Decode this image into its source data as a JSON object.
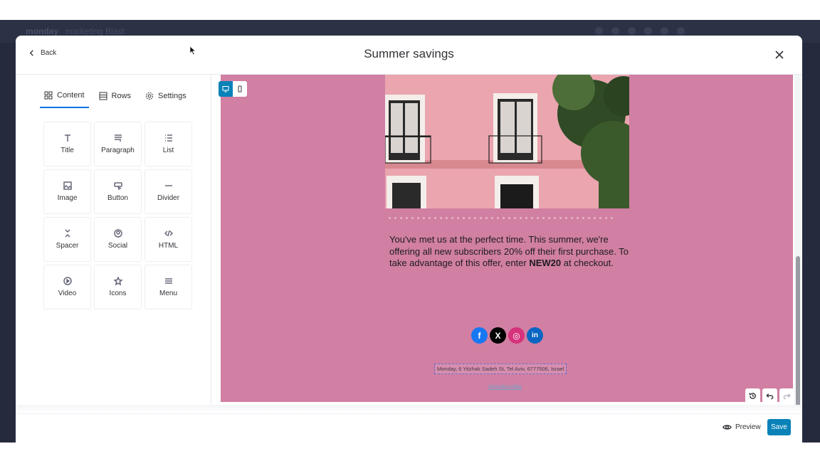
{
  "backdrop": {
    "logo": "monday",
    "crumb": "marketing   Blast"
  },
  "modal": {
    "title": "Summer savings",
    "back_label": "Back"
  },
  "panel": {
    "tabs": [
      {
        "label": "Content",
        "icon": "grid-icon"
      },
      {
        "label": "Rows",
        "icon": "rows-icon"
      },
      {
        "label": "Settings",
        "icon": "gear-icon"
      }
    ],
    "blocks": [
      {
        "label": "Title",
        "icon": "text-t-icon"
      },
      {
        "label": "Paragraph",
        "icon": "paragraph-icon"
      },
      {
        "label": "List",
        "icon": "list-icon"
      },
      {
        "label": "Image",
        "icon": "image-icon"
      },
      {
        "label": "Button",
        "icon": "button-icon"
      },
      {
        "label": "Divider",
        "icon": "divider-icon"
      },
      {
        "label": "Spacer",
        "icon": "spacer-icon"
      },
      {
        "label": "Social",
        "icon": "user-circle-icon"
      },
      {
        "label": "HTML",
        "icon": "code-icon"
      },
      {
        "label": "Video",
        "icon": "play-icon"
      },
      {
        "label": "Icons",
        "icon": "star-icon"
      },
      {
        "label": "Menu",
        "icon": "menu-icon"
      }
    ]
  },
  "email": {
    "body_part1": "You've met us at the perfect time. This summer, we're offering all new subscribers 20% off their first purchase. To take advantage of this offer, enter ",
    "promo_code": "NEW20",
    "body_part2": " at checkout.",
    "socials": [
      {
        "name": "facebook",
        "glyph": "f",
        "color": "#1877f2"
      },
      {
        "name": "x",
        "glyph": "X",
        "color": "#000000"
      },
      {
        "name": "instagram",
        "glyph": "◎",
        "color": "#d6327c"
      },
      {
        "name": "linkedin",
        "glyph": "in",
        "color": "#0a66c2"
      }
    ],
    "address": "Monday, 6 Yitzhak Sadeh St, Tel Aviv, 6777506, Israel",
    "unsubscribe": "Unsubscribe"
  },
  "colors": {
    "canvas_bg": "#d17fa3",
    "accent": "#0a82b8"
  },
  "footer": {
    "preview_label": "Preview",
    "save_label": "Save"
  }
}
